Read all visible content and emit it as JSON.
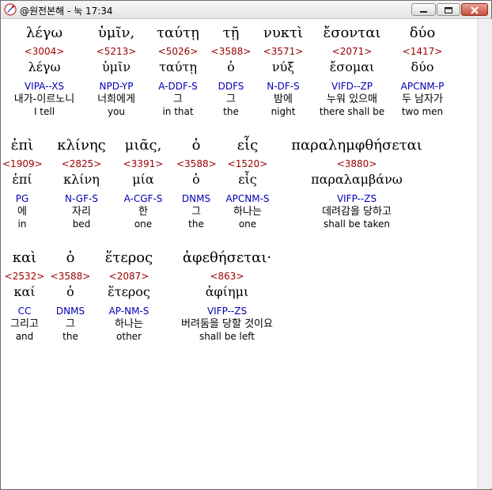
{
  "window": {
    "title": "@원전본해 - 눅 17:34"
  },
  "rows": [
    [
      {
        "greek": "λέγω",
        "strongs": "<3004>",
        "lemma": "λέγω",
        "parsing": "VIPA--XS",
        "korean": "내가-이르노니",
        "english": "I tell"
      },
      {
        "greek": "ὑμῖν,",
        "strongs": "<5213>",
        "lemma": "ὑμῖν",
        "parsing": "NPD-YP",
        "korean": "너희에게",
        "english": "you"
      },
      {
        "greek": "ταύτῃ",
        "strongs": "<5026>",
        "lemma": "ταύτῃ",
        "parsing": "A-DDF-S",
        "korean": "그",
        "english": "in that"
      },
      {
        "greek": "τῇ",
        "strongs": "<3588>",
        "lemma": "ὁ",
        "parsing": "DDFS",
        "korean": "그",
        "english": "the"
      },
      {
        "greek": "νυκτὶ",
        "strongs": "<3571>",
        "lemma": "νύξ",
        "parsing": "N-DF-S",
        "korean": "밤에",
        "english": "night"
      },
      {
        "greek": "ἔσονται",
        "strongs": "<2071>",
        "lemma": "ἔσομαι",
        "parsing": "VIFD--ZP",
        "korean": "누워 있으매",
        "english": "there shall be"
      },
      {
        "greek": "δύο",
        "strongs": "<1417>",
        "lemma": "δύο",
        "parsing": "APCNM-P",
        "korean": "두 남자가",
        "english": "two men"
      }
    ],
    [
      {
        "greek": "ἐπὶ",
        "strongs": "<1909>",
        "lemma": "ἐπί",
        "parsing": "PG",
        "korean": "에",
        "english": "in"
      },
      {
        "greek": "κλίνης",
        "strongs": "<2825>",
        "lemma": "κλίνη",
        "parsing": "N-GF-S",
        "korean": "자리",
        "english": "bed"
      },
      {
        "greek": "μιᾶς,",
        "strongs": "<3391>",
        "lemma": "μία",
        "parsing": "A-CGF-S",
        "korean": "한",
        "english": "one"
      },
      {
        "greek": "ὁ",
        "strongs": "<3588>",
        "lemma": "ὁ",
        "parsing": "DNMS",
        "korean": "그",
        "english": "the"
      },
      {
        "greek": "εἷς",
        "strongs": "<1520>",
        "lemma": "εἷς",
        "parsing": "APCNM-S",
        "korean": "하나는",
        "english": "one"
      },
      {
        "greek": "παραλημφθήσεται",
        "strongs": "<3880>",
        "lemma": "παραλαμβάνω",
        "parsing": "VIFP--ZS",
        "korean": "데려감을 당하고",
        "english": "shall be taken"
      }
    ],
    [
      {
        "greek": "καὶ",
        "strongs": "<2532>",
        "lemma": "καί",
        "parsing": "CC",
        "korean": "그리고",
        "english": "and"
      },
      {
        "greek": "ὁ",
        "strongs": "<3588>",
        "lemma": "ὁ",
        "parsing": "DNMS",
        "korean": "그",
        "english": "the"
      },
      {
        "greek": "ἕτερος",
        "strongs": "<2087>",
        "lemma": "ἕτερος",
        "parsing": "AP-NM-S",
        "korean": "하나는",
        "english": "other"
      },
      {
        "greek": "ἀφεθήσεται·",
        "strongs": "<863>",
        "lemma": "ἀφίημι",
        "parsing": "VIFP--ZS",
        "korean": "버려둠을 당할 것이요",
        "english": "shall be left"
      }
    ]
  ]
}
